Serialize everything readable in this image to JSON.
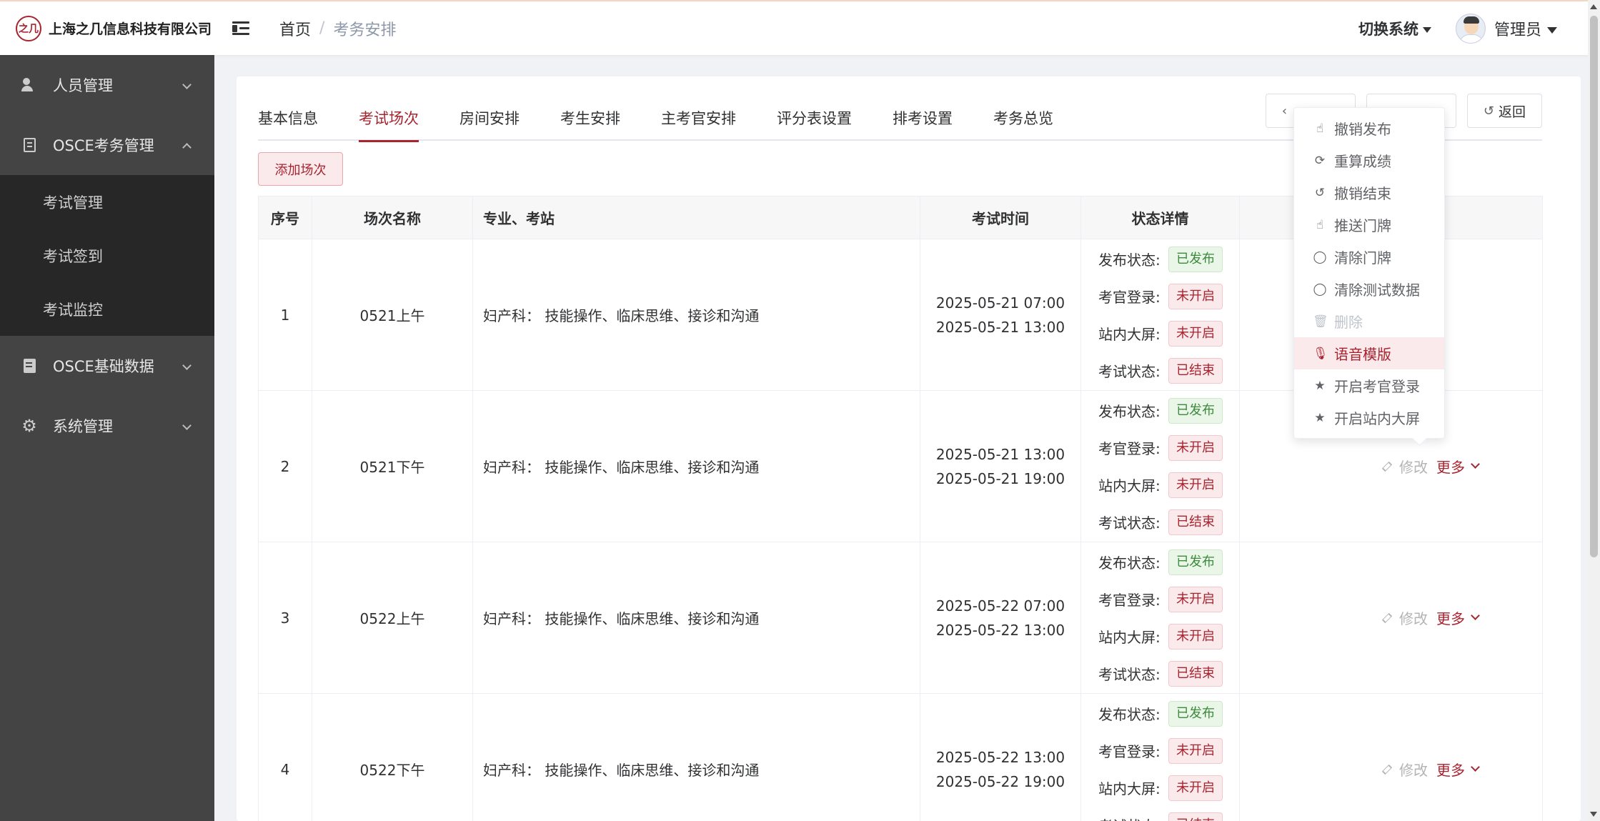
{
  "header": {
    "logo_mark": "之几",
    "company": "上海之几信息科技有限公司",
    "breadcrumb": [
      "首页",
      "/",
      "考务安排"
    ],
    "switch_system": "切换系统",
    "user": "管理员"
  },
  "sidebar": {
    "items": [
      {
        "label": "人员管理",
        "icon": "users-icon"
      },
      {
        "label": "OSCE考务管理",
        "icon": "document-icon",
        "expanded": true,
        "children": [
          "考试管理",
          "考试签到",
          "考试监控"
        ]
      },
      {
        "label": "OSCE基础数据",
        "icon": "data-icon"
      },
      {
        "label": "系统管理",
        "icon": "gear-icon"
      }
    ]
  },
  "tabs": [
    "基本信息",
    "考试场次",
    "房间安排",
    "考生安排",
    "主考官安排",
    "评分表设置",
    "排考设置",
    "考务总览"
  ],
  "active_tab": 1,
  "tab_buttons": {
    "back": "返回"
  },
  "add_button": "添加场次",
  "table": {
    "columns": [
      "序号",
      "场次名称",
      "专业、考站",
      "考试时间",
      "状态详情"
    ],
    "status_labels": [
      "发布状态:",
      "考官登录:",
      "站内大屏:",
      "考试状态:"
    ],
    "rows": [
      {
        "no": "1",
        "name": "0521上午",
        "major": "妇产科：  技能操作、临床思维、接诊和沟通",
        "start": "2025-05-21 07:00",
        "end": "2025-05-21 13:00",
        "status": [
          "已发布",
          "未开启",
          "未开启",
          "已结束"
        ]
      },
      {
        "no": "2",
        "name": "0521下午",
        "major": "妇产科：  技能操作、临床思维、接诊和沟通",
        "start": "2025-05-21 13:00",
        "end": "2025-05-21 19:00",
        "status": [
          "已发布",
          "未开启",
          "未开启",
          "已结束"
        ]
      },
      {
        "no": "3",
        "name": "0522上午",
        "major": "妇产科：  技能操作、临床思维、接诊和沟通",
        "start": "2025-05-22 07:00",
        "end": "2025-05-22 13:00",
        "status": [
          "已发布",
          "未开启",
          "未开启",
          "已结束"
        ]
      },
      {
        "no": "4",
        "name": "0522下午",
        "major": "妇产科：  技能操作、临床思维、接诊和沟通",
        "start": "2025-05-22 13:00",
        "end": "2025-05-22 19:00",
        "status": [
          "已发布",
          "未开启",
          "未开启",
          "已结束"
        ]
      }
    ],
    "op_edit": "修改",
    "op_more": "更多"
  },
  "dropdown": {
    "items": [
      {
        "label": "撤销发布",
        "icon": "hand-pointer-icon"
      },
      {
        "label": "重算成绩",
        "icon": "refresh-icon"
      },
      {
        "label": "撤销结束",
        "icon": "undo-icon"
      },
      {
        "label": "推送门牌",
        "icon": "hand-pointer-icon"
      },
      {
        "label": "清除门牌",
        "icon": "chat-bubble-icon"
      },
      {
        "label": "清除测试数据",
        "icon": "chat-bubble-icon"
      },
      {
        "label": "删除",
        "icon": "trash-icon",
        "disabled": true
      },
      {
        "label": "语音模版",
        "icon": "microphone-icon",
        "hover": true
      },
      {
        "label": "开启考官登录",
        "icon": "star-icon"
      },
      {
        "label": "开启站内大屏",
        "icon": "star-icon"
      }
    ]
  },
  "colors": {
    "accent": "#a8242f",
    "sidebar": "#444444",
    "submenu": "#272727",
    "success": "#3c8a3c"
  }
}
